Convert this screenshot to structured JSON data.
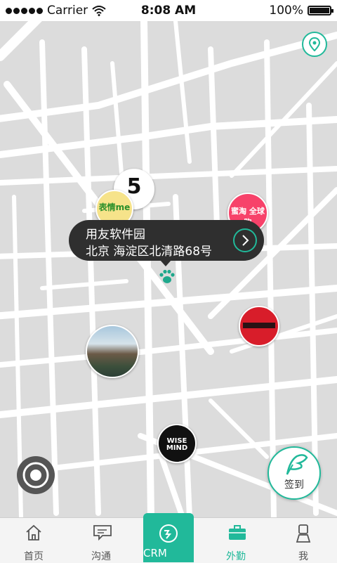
{
  "status_bar": {
    "carrier": "Carrier",
    "time": "8:08 AM",
    "battery": "100%",
    "wifi_icon": "wifi-icon",
    "battery_icon": "battery-icon"
  },
  "map": {
    "locate_icon": "location-pin-icon",
    "callout": {
      "name": "用友软件园",
      "address": "北京 海淀区北清路68号",
      "arrow_icon": "chevron-right-icon"
    },
    "current_location_icon": "paw-icon",
    "markers": [
      {
        "name": "5 stores logo marker",
        "text": "5"
      },
      {
        "name": "表情 me logo marker",
        "text": "表情me"
      },
      {
        "name": "蜜淘 logo marker",
        "text": "蜜淘 全球购"
      },
      {
        "name": "red logo marker",
        "text": ""
      },
      {
        "name": "landscape photo marker",
        "text": ""
      },
      {
        "name": "Wise Mind logo marker",
        "text": "WISE MIND"
      }
    ],
    "compass_icon": "compass-icon",
    "checkin_label": "签到",
    "checkin_icon": "feather-icon"
  },
  "tabs": [
    {
      "label": "首页",
      "icon": "home-icon",
      "active": false
    },
    {
      "label": "沟通",
      "icon": "chat-icon",
      "active": false
    },
    {
      "label": "CRM",
      "icon": "crm-icon",
      "active": false
    },
    {
      "label": "外勤",
      "icon": "briefcase-icon",
      "active": true
    },
    {
      "label": "我",
      "icon": "user-icon",
      "active": false
    }
  ],
  "colors": {
    "accent": "#21b99a",
    "map_background": "#dcdcdc",
    "road": "#ffffff",
    "callout_bg": "#2f2f2f"
  }
}
